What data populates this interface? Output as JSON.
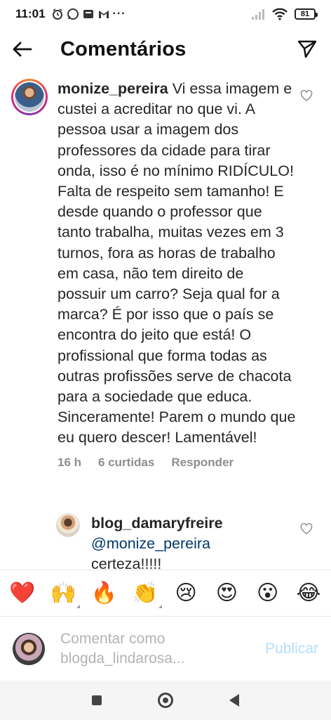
{
  "status_bar": {
    "time": "11:01",
    "battery": "81"
  },
  "header": {
    "title": "Comentários"
  },
  "comment": {
    "username": "monize_pereira",
    "text": "Vi essa imagem e custei a acreditar no que vi. A pessoa usar a imagem dos professores da cidade para tirar onda, isso é no mínimo RIDÍCULO! Falta de respeito sem tamanho! E desde quando o professor que tanto trabalha, muitas vezes em 3 turnos, fora as horas de trabalho em casa, não tem direito de possuir um carro? Seja qual for a marca? É por isso que o país se encontra do jeito que está! O profissional que forma todas as outras profissões serve de chacota para a sociedade que educa. Sinceramente! Parem o mundo que eu quero descer! Lamentável!",
    "time": "16 h",
    "likes": "6 curtidas",
    "reply_label": "Responder"
  },
  "reply": {
    "username": "blog_damaryfreire",
    "mention": "@monize_pereira",
    "text": "certeza!!!!!"
  },
  "emoji_bar": {
    "items": [
      "❤️",
      "🙌",
      "🔥",
      "👏",
      "😢",
      "😍",
      "😮",
      "😂"
    ]
  },
  "composer": {
    "placeholder_line1": "Comentar como",
    "placeholder_line2": "blogda_lindarosa...",
    "publish_label": "Publicar"
  },
  "colors": {
    "publish_disabled": "#b2dffc",
    "mention": "#00376b",
    "meta_gray": "#8e8e8e"
  }
}
